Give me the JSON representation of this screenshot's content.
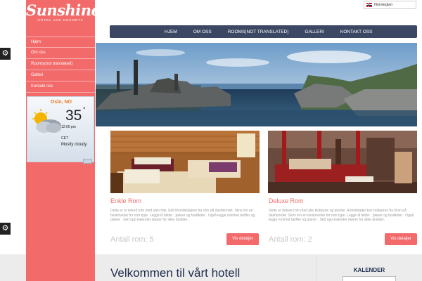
{
  "brand": {
    "name": "Sunshine",
    "tagline": "HOTEL AND RESORTS"
  },
  "language": {
    "selected": "Norwegian"
  },
  "sidebar": {
    "items": [
      {
        "label": "Hjem"
      },
      {
        "label": "Om oss"
      },
      {
        "label": "Rooms(not translated)"
      },
      {
        "label": "Galleri"
      },
      {
        "label": "Kontakt oss"
      }
    ]
  },
  "weather": {
    "city": "Oslo, NO",
    "temperature": "35",
    "degree": "°",
    "time": "12:00 pm",
    "tz": "CET",
    "condition": "Mostly cloudy",
    "icon": "partly-cloudy-icon"
  },
  "nav": {
    "items": [
      {
        "label": "HJEM"
      },
      {
        "label": "OM OSS"
      },
      {
        "label": "ROOMS(NOT TRANSLATED)"
      },
      {
        "label": "GALLERI"
      },
      {
        "label": "KONTAKT OSS"
      }
    ]
  },
  "rooms": [
    {
      "title": "Enkle Rom",
      "description": "Dette er et enkelt rom med ulen frits. Edit Romdetaljene fra rom på dashbordet. Skriv inn en beskrivelse for rom type. Legge til bilder , planer og fasiliteter . Også legge rommet tariffer og planer . Sett opp kalender datoer for slike årstider.",
      "count_label": "Antall rom:",
      "count": "5",
      "button": "Vis detaljer"
    },
    {
      "title": "Deluxe Rom",
      "description": "Dette er deluxe rom med alle klokkene og plystre. Romdetaljer kan redigeres fra Rom på dashbordet. Skriv inn en beskrivelse for rom type. Legge til bilder , planer og fasiliteter . Også legge rommet tariffer og planer . Sett opp kalender datoer for slike årstider.",
      "count_label": "Antall rom:",
      "count": "2",
      "button": "Vis detaljer"
    }
  ],
  "welcome": {
    "heading": "Velkommen til vårt hotell"
  },
  "calendar": {
    "title": "KALENDER"
  },
  "colors": {
    "accent": "#f26a6a",
    "nav": "#3b4763",
    "heading": "#1f2d4d"
  }
}
